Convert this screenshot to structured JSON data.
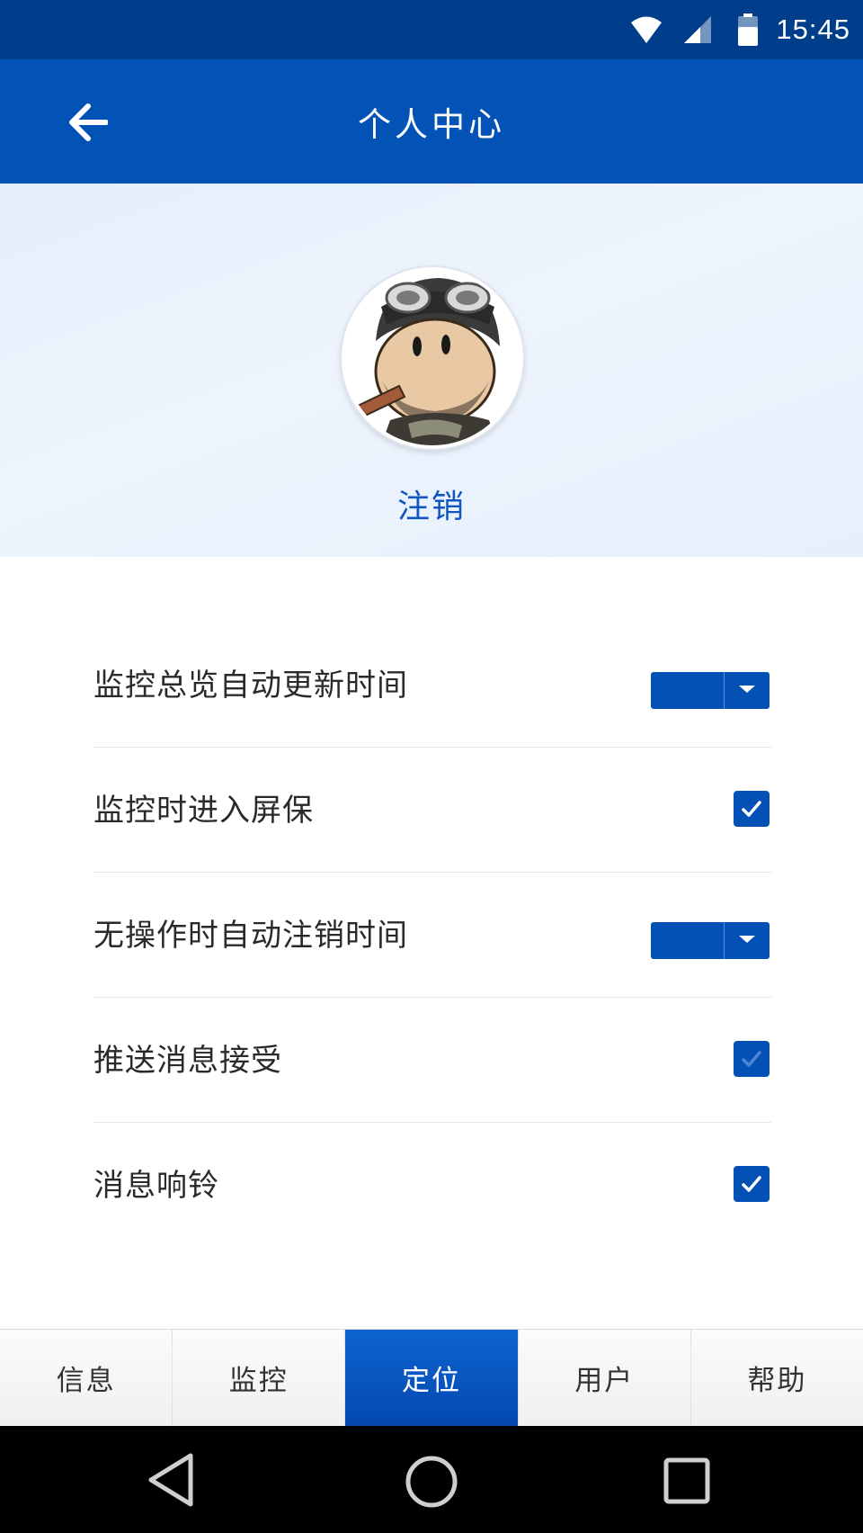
{
  "status_bar": {
    "time": "15:45",
    "icons": [
      "wifi-icon",
      "cell-signal-icon",
      "battery-icon"
    ]
  },
  "app_bar": {
    "title": "个人中心",
    "back_icon": "arrow-left-icon"
  },
  "profile": {
    "avatar": "avatar-cartoon-soldier",
    "logout_label": "注销"
  },
  "settings": {
    "items": [
      {
        "label": "监控总览自动更新时间",
        "control": "select",
        "value": ""
      },
      {
        "label": "监控时进入屏保",
        "control": "checkbox",
        "checked": true
      },
      {
        "label": "无操作时自动注销时间",
        "control": "select",
        "value": ""
      },
      {
        "label": "推送消息接受",
        "control": "checkbox",
        "checked": true,
        "disabled_look": true
      },
      {
        "label": "消息响铃",
        "control": "checkbox",
        "checked": true
      }
    ]
  },
  "tabs": {
    "items": [
      {
        "label": "信息",
        "active": false
      },
      {
        "label": "监控",
        "active": false
      },
      {
        "label": "定位",
        "active": true
      },
      {
        "label": "用户",
        "active": false
      },
      {
        "label": "帮助",
        "active": false
      }
    ]
  },
  "nav_bar": {
    "icons": [
      "nav-back-icon",
      "nav-home-icon",
      "nav-recents-icon"
    ]
  },
  "colors": {
    "status_bar": "#003e8c",
    "app_bar": "#0352b6",
    "accent": "#0451b5",
    "link": "#1155c0"
  }
}
